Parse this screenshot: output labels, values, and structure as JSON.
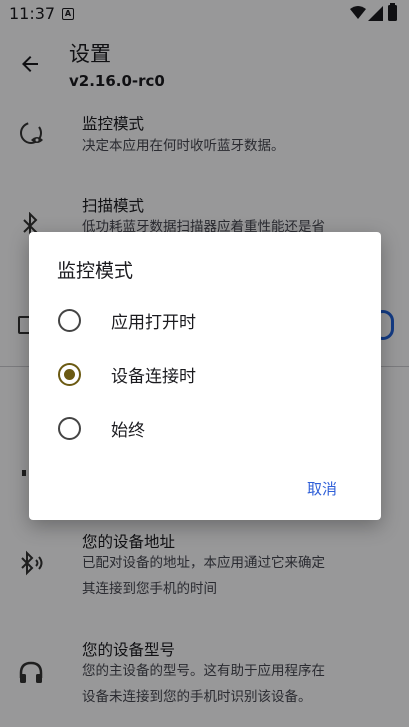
{
  "status_bar": {
    "time": "11:37",
    "notification_icon": "a-icon"
  },
  "app_bar": {
    "title": "设置",
    "version": "v2.16.0-rc0"
  },
  "settings": [
    {
      "icon": "monitor-eye-icon",
      "title": "监控模式",
      "desc": [
        "决定本应用在何时收听蓝牙数据。"
      ]
    },
    {
      "icon": "bluetooth-icon",
      "title": "扫描模式",
      "desc": [
        "低功耗蓝牙数据扫描器应着重性能还是省"
      ]
    },
    {
      "icon": "bluetooth-audio-icon",
      "title": "您的设备地址",
      "desc": [
        "已配对设备的地址，本应用通过它来确定",
        "其连接到您手机的时间"
      ]
    },
    {
      "icon": "headphones-icon",
      "title": "您的设备型号",
      "desc": [
        "您的主设备的型号。这有助于应用程序在",
        "设备未连接到您的手机时识别该设备。"
      ]
    }
  ],
  "dialog": {
    "title": "监控模式",
    "options": [
      {
        "label": "应用打开时",
        "selected": false
      },
      {
        "label": "设备连接时",
        "selected": true
      },
      {
        "label": "始终",
        "selected": false
      }
    ],
    "cancel_label": "取消"
  },
  "colors": {
    "accent": "#2f5fd8",
    "radio_selected": "#6b5a12",
    "scrim": "rgba(0,0,0,0.38)"
  }
}
